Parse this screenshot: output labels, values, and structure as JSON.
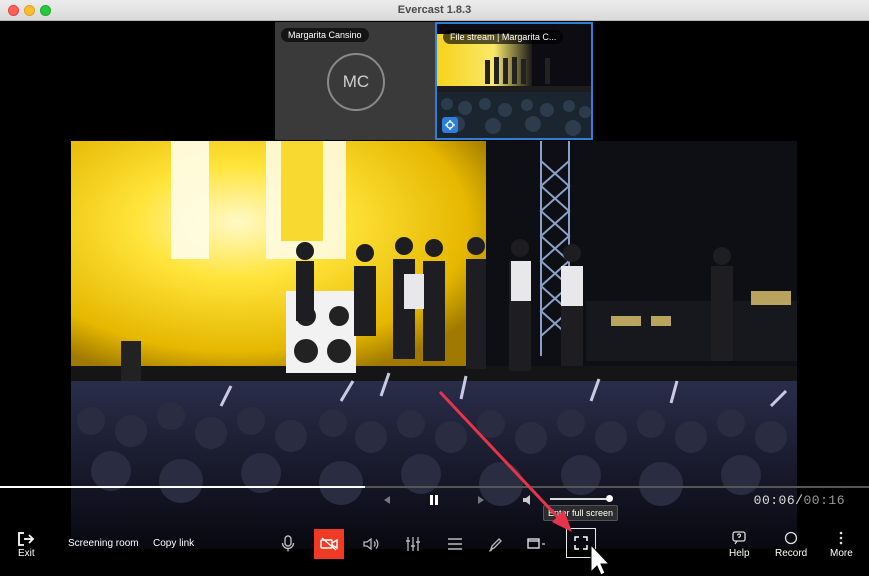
{
  "window": {
    "title": "Evercast 1.8.3"
  },
  "tiles": {
    "participant": {
      "label": "Margarita Cansino",
      "initials": "MC"
    },
    "file_stream": {
      "label": "File stream | Margarita C..."
    }
  },
  "player": {
    "current_time": "00:06",
    "separator": "/",
    "total_time": "00:16",
    "progress_fraction": 0.42,
    "volume_fraction": 0.95,
    "tooltip": "Enter full screen"
  },
  "toolbar": {
    "exit_label": "Exit",
    "screening_room_label": "Screening room",
    "copy_link_label": "Copy link",
    "help_label": "Help",
    "record_label": "Record",
    "more_label": "More"
  },
  "colors": {
    "accent_blue": "#2f7fd6",
    "camera_off_red": "#ef3b24",
    "annotation_arrow": "#e8344a"
  },
  "icons": {
    "exit": "exit-arrow-icon",
    "mic": "microphone-icon",
    "camera_off": "video-off-icon",
    "speaker": "speaker-icon",
    "mixer": "sliders-icon",
    "menu": "hamburger-icon",
    "draw": "pen-icon",
    "layout": "window-layout-icon",
    "fullscreen": "fullscreen-icon",
    "help": "help-icon",
    "record": "record-icon",
    "more": "more-dots-icon",
    "prev": "skip-back-icon",
    "pause": "pause-icon",
    "next": "skip-forward-icon",
    "volume": "volume-icon"
  }
}
